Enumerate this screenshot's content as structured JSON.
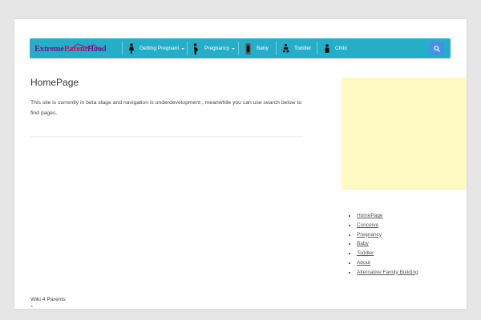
{
  "header": {
    "logo": {
      "part1": "Extreme",
      "part2": "Parent",
      "part3": "Hood"
    },
    "nav": [
      {
        "label": "Getting Pregnant",
        "icon": "woman-silhouette-icon",
        "has_dropdown": true
      },
      {
        "label": "Pregnancy",
        "icon": "pregnant-woman-icon",
        "has_dropdown": true
      },
      {
        "label": "Baby",
        "icon": "baby-bottle-icon",
        "has_dropdown": false
      },
      {
        "label": "Toddler",
        "icon": "stroller-icon",
        "has_dropdown": false
      },
      {
        "label": "Child",
        "icon": "child-icon",
        "has_dropdown": false
      }
    ],
    "search_icon": "search-icon",
    "accent_color": "#26aec9",
    "search_button_color": "#4a90e2"
  },
  "main": {
    "title": "HomePage",
    "intro": "This site is currently in beta stage and navigation is underdevelopment , meanwhile you can use search below to find pages."
  },
  "sidebar": {
    "ad_color": "#fff9c4",
    "links": [
      "HomePage",
      "Conceive",
      "Pregnancy",
      "Baby",
      "Toddler",
      "About",
      "Alternative Family Building"
    ]
  },
  "footer": {
    "text": "Wiki 4 Parents",
    "mark": "^"
  }
}
